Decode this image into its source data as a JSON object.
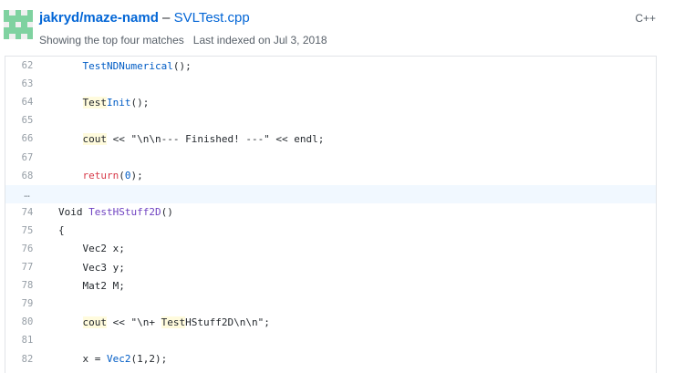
{
  "result": {
    "repo": "jakryd/maze-namd",
    "separator": " – ",
    "file": "SVLTest.cpp",
    "matches_text": "Showing the top four matches",
    "indexed_text": "Last indexed on Jul 3, 2018",
    "language": "C++"
  },
  "colors": {
    "avatar_fg": "#7fd2a0",
    "avatar_bg": "#f0f0f0",
    "link": "#0366d6",
    "highlight": "#fffbdd"
  },
  "code": {
    "lines": [
      {
        "n": "62",
        "segments": [
          {
            "t": "    "
          },
          {
            "t": "TestNDNumerical",
            "c": "num"
          },
          {
            "t": "();"
          }
        ]
      },
      {
        "n": "63",
        "segments": []
      },
      {
        "n": "64",
        "segments": [
          {
            "t": "    "
          },
          {
            "t": "Test",
            "c": "hl"
          },
          {
            "t": "Init",
            "c": "num"
          },
          {
            "t": "();"
          }
        ]
      },
      {
        "n": "65",
        "segments": []
      },
      {
        "n": "66",
        "segments": [
          {
            "t": "    "
          },
          {
            "t": "cout",
            "c": "hl"
          },
          {
            "t": " << \"\\n\\n--- Finished! ---\" << endl;"
          }
        ]
      },
      {
        "n": "67",
        "segments": []
      },
      {
        "n": "68",
        "segments": [
          {
            "t": "    "
          },
          {
            "t": "return",
            "c": "kw"
          },
          {
            "t": "("
          },
          {
            "t": "0",
            "c": "num"
          },
          {
            "t": ");"
          }
        ]
      },
      {
        "n": "…",
        "divider": true,
        "segments": []
      },
      {
        "n": "74",
        "segments": [
          {
            "t": "Void "
          },
          {
            "t": "TestHStuff2D",
            "c": "fn"
          },
          {
            "t": "()"
          }
        ]
      },
      {
        "n": "75",
        "segments": [
          {
            "t": "{"
          }
        ]
      },
      {
        "n": "76",
        "segments": [
          {
            "t": "    Vec2 x;"
          }
        ]
      },
      {
        "n": "77",
        "segments": [
          {
            "t": "    Vec3 y;"
          }
        ]
      },
      {
        "n": "78",
        "segments": [
          {
            "t": "    Mat2 M;"
          }
        ]
      },
      {
        "n": "79",
        "segments": []
      },
      {
        "n": "80",
        "segments": [
          {
            "t": "    "
          },
          {
            "t": "cout",
            "c": "hl"
          },
          {
            "t": " << \"\\n+ "
          },
          {
            "t": "Test",
            "c": "hl"
          },
          {
            "t": "HStuff2D\\n\\n\";"
          }
        ]
      },
      {
        "n": "81",
        "segments": []
      },
      {
        "n": "82",
        "segments": [
          {
            "t": "    x = "
          },
          {
            "t": "Vec2",
            "c": "num"
          },
          {
            "t": "(1,2);"
          }
        ]
      }
    ]
  }
}
